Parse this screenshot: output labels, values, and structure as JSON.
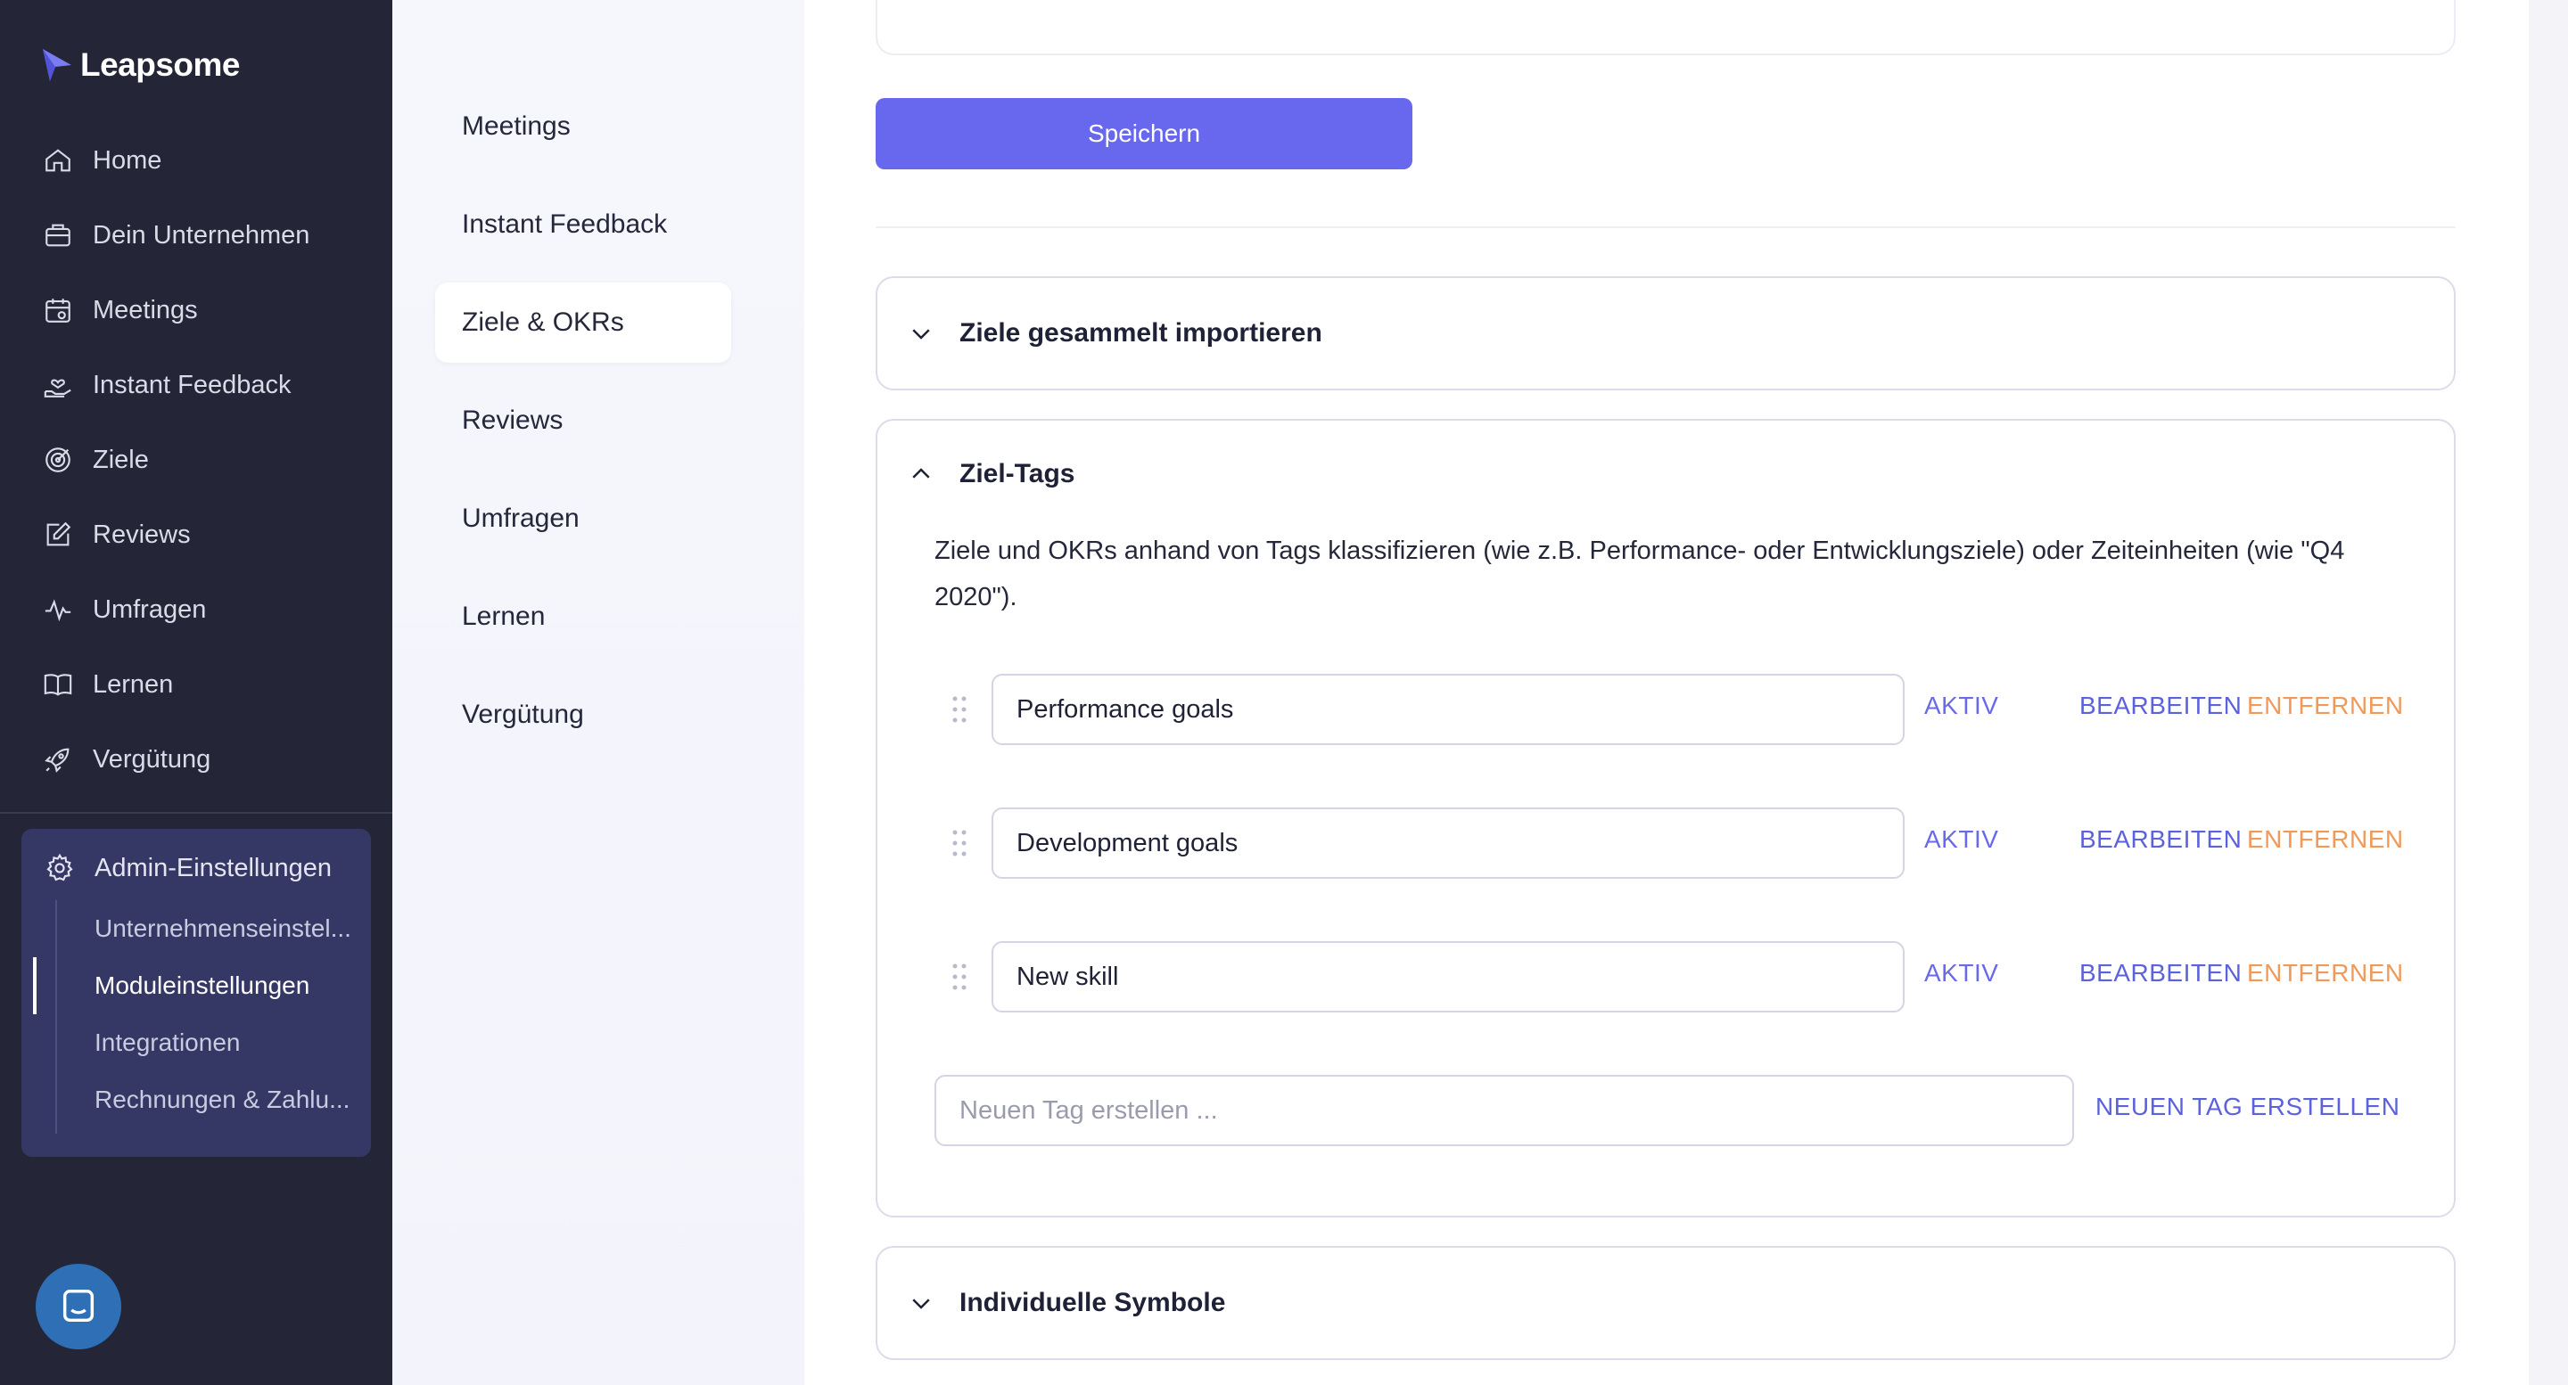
{
  "brand": {
    "name": "Leapsome",
    "accent": "#6868ee",
    "sidebar_bg": "#242638"
  },
  "sidebar": {
    "items": [
      {
        "label": "Home",
        "icon": "home-icon"
      },
      {
        "label": "Dein Unternehmen",
        "icon": "briefcase-icon"
      },
      {
        "label": "Meetings",
        "icon": "calendar-icon"
      },
      {
        "label": "Instant Feedback",
        "icon": "hand-heart-icon"
      },
      {
        "label": "Ziele",
        "icon": "target-icon"
      },
      {
        "label": "Reviews",
        "icon": "edit-icon"
      },
      {
        "label": "Umfragen",
        "icon": "pulse-icon"
      },
      {
        "label": "Lernen",
        "icon": "book-icon"
      },
      {
        "label": "Vergütung",
        "icon": "rocket-icon"
      }
    ],
    "admin": {
      "label": "Admin-Einstellungen",
      "icon": "gear-icon",
      "sub_items": [
        {
          "label": "Unternehmenseinstel..."
        },
        {
          "label": "Moduleinstellungen",
          "active": true
        },
        {
          "label": "Integrationen"
        },
        {
          "label": "Rechnungen & Zahlu..."
        }
      ]
    },
    "chat_icon": "chat-icon"
  },
  "subnav": {
    "items": [
      {
        "label": "Meetings"
      },
      {
        "label": "Instant Feedback"
      },
      {
        "label": "Ziele & OKRs",
        "active": true
      },
      {
        "label": "Reviews"
      },
      {
        "label": "Umfragen"
      },
      {
        "label": "Lernen"
      },
      {
        "label": "Vergütung"
      }
    ]
  },
  "main": {
    "save_label": "Speichern",
    "panels": {
      "import": {
        "title": "Ziele gesammelt importieren",
        "expanded": false
      },
      "tags": {
        "title": "Ziel-Tags",
        "expanded": true,
        "description": "Ziele und OKRs anhand von Tags klassifizieren (wie z.B. Performance- oder Entwicklungsziele) oder Zeiteinheiten (wie \"Q4 2020\").",
        "tags": [
          {
            "value": "Performance goals",
            "aktiv": "AKTIV",
            "edit": "BEARBEITEN",
            "remove": "ENTFERNEN"
          },
          {
            "value": "Development goals",
            "aktiv": "AKTIV",
            "edit": "BEARBEITEN",
            "remove": "ENTFERNEN"
          },
          {
            "value": "New skill",
            "aktiv": "AKTIV",
            "edit": "BEARBEITEN",
            "remove": "ENTFERNEN"
          }
        ],
        "new_tag_placeholder": "Neuen Tag erstellen ...",
        "new_tag_button": "NEUEN TAG ERSTELLEN"
      },
      "symbols": {
        "title": "Individuelle Symbole",
        "expanded": false
      }
    }
  }
}
